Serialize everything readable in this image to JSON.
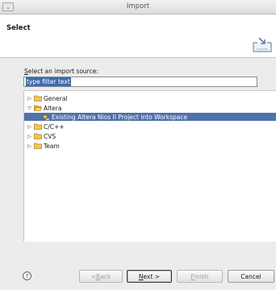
{
  "window": {
    "title": "Import",
    "menu_glyph": "⌄"
  },
  "banner": {
    "heading": "Select",
    "icon": "import-wizard-icon"
  },
  "source": {
    "label_mnemonic": "S",
    "label_rest": "elect an import source:",
    "filter_text": "type filter text"
  },
  "tree": {
    "items": [
      {
        "label": "General",
        "expanded": false,
        "level": 0,
        "icon": "folder-icon"
      },
      {
        "label": "Altera",
        "expanded": true,
        "level": 0,
        "icon": "folder-open-icon"
      },
      {
        "label": "Existing Altera Nios II Project into Workspace",
        "level": 1,
        "selected": true,
        "icon": "project-icon"
      },
      {
        "label": "C/C++",
        "expanded": false,
        "level": 0,
        "icon": "folder-icon"
      },
      {
        "label": "CVS",
        "expanded": false,
        "level": 0,
        "icon": "folder-icon"
      },
      {
        "label": "Team",
        "expanded": false,
        "level": 0,
        "icon": "folder-icon"
      }
    ],
    "glyph_collapsed": "▷",
    "glyph_expanded": "▽"
  },
  "footer": {
    "help_glyph": "?",
    "back": {
      "prefix": "< ",
      "mnemonic": "B",
      "rest": "ack",
      "enabled": false
    },
    "next": {
      "mnemonic": "N",
      "rest": "ext >",
      "enabled": true
    },
    "finish": {
      "mnemonic": "F",
      "rest": "inish",
      "enabled": false
    },
    "cancel": {
      "label": "Cancel",
      "enabled": true
    }
  },
  "colors": {
    "selection": "#4e72aa",
    "folder": "#e8b84a"
  }
}
